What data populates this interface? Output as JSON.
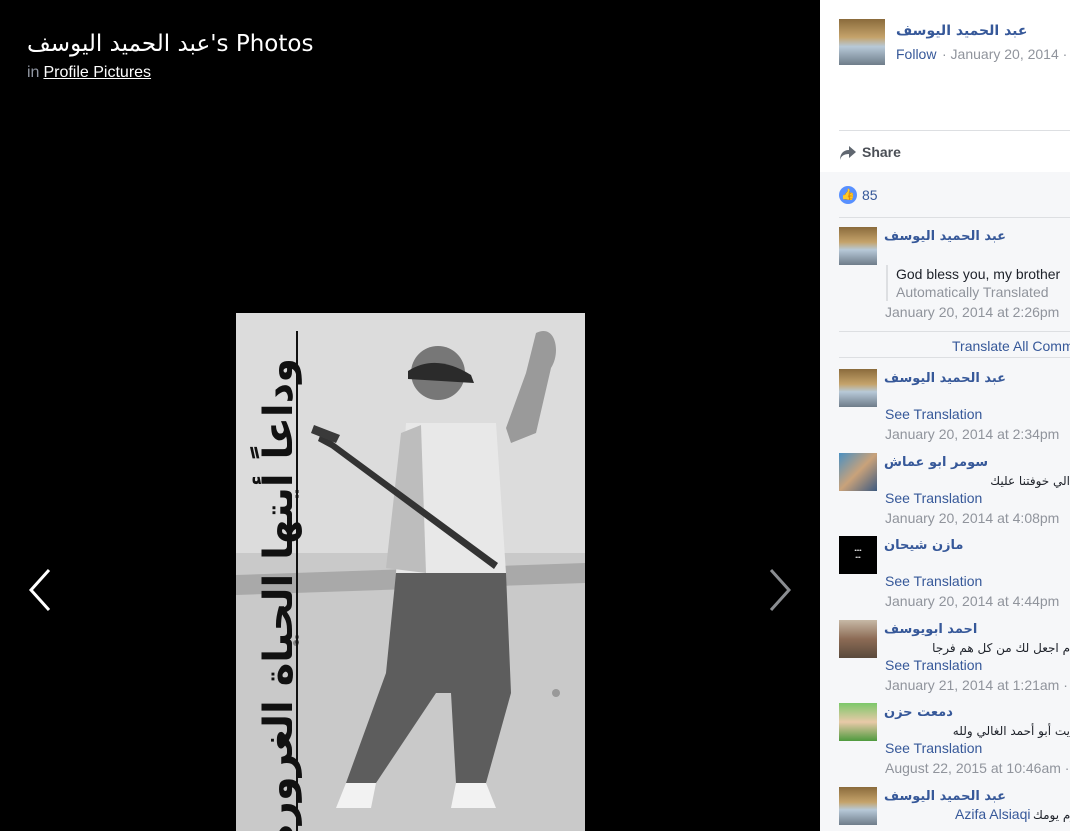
{
  "viewer": {
    "title": "عبد الحميد اليوسف's Photos",
    "in_label": "in",
    "album_link": "Profile Pictures"
  },
  "photo": {
    "caption_text": "وداعاً أيتها الحياة الغرورة"
  },
  "post": {
    "author": "عبد الحميد اليوسف",
    "follow_label": "Follow",
    "date": "· January 20, 2014 ·",
    "share_label": "Share",
    "like_count": "85"
  },
  "translate_all_label": "Translate All Comments",
  "comments": [
    {
      "author": "عبد الحميد اليوسف",
      "text": "God bless you, my brother",
      "auto_label": "Automatically Translated",
      "time": "January 20, 2014 at 2:26pm"
    },
    {
      "author": "عبد الحميد اليوسف",
      "see_translation": "See Translation",
      "time": "January 20, 2014 at 2:34pm"
    },
    {
      "author": "سومر ابو عماش",
      "text": "الي خوفتنا عليك",
      "see_translation": "See Translation",
      "time": "January 20, 2014 at 4:08pm"
    },
    {
      "author": "مازن شيحان",
      "see_translation": "See Translation",
      "time": "January 20, 2014 at 4:44pm"
    },
    {
      "author": "احمد ابويوسف",
      "text": "م اجعل لك من كل هم فرجا",
      "see_translation": "See Translation",
      "time": "January 21, 2014 at 1:21am ·"
    },
    {
      "author": "دمعت حزن",
      "text": "يت أبو أحمد الغالي ولله",
      "see_translation": "See Translation",
      "time": "August 22, 2015 at 10:46am ·"
    },
    {
      "author": "عبد الحميد اليوسف",
      "mention": "Azifa Alsiaqi",
      "text": "وم يومك"
    }
  ],
  "colors": {
    "link": "#365899",
    "meta_gray": "#90949c",
    "like_blue": "#5890ff"
  }
}
